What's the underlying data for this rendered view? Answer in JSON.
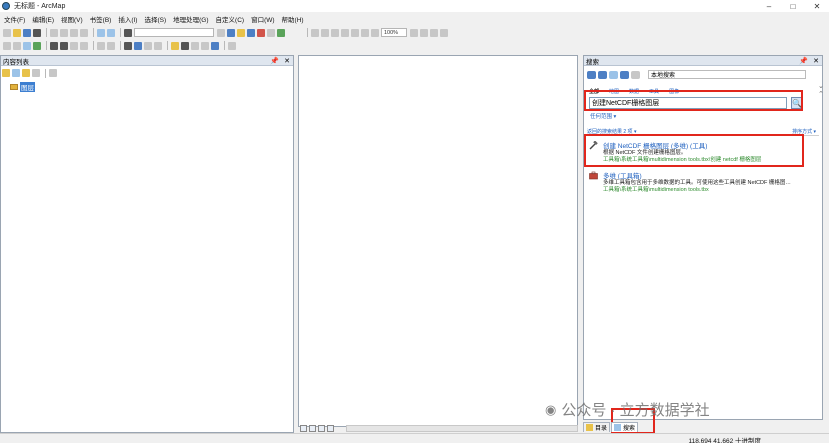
{
  "window": {
    "title": "无标题 - ArcMap",
    "minimize": "–",
    "maximize": "□",
    "close": "✕"
  },
  "menu": [
    "文件(F)",
    "编辑(E)",
    "视图(V)",
    "书签(B)",
    "插入(I)",
    "选择(S)",
    "地理处理(G)",
    "自定义(C)",
    "窗口(W)",
    "帮助(H)"
  ],
  "toolbar": {
    "zoom_value": "100%"
  },
  "toc": {
    "title": "内容列表",
    "layer_label": "图层"
  },
  "search_panel": {
    "title": "搜索",
    "scope_label": "本地搜索",
    "filters": [
      "全部",
      "地图",
      "数据",
      "工具",
      "图像"
    ],
    "query": "创建NetCDF栅格图层",
    "scope_link": "任何范围 ▾",
    "result_count": "返回的搜索结果 2 项 ▾",
    "sort_label": "排序方式 ▾",
    "results": [
      {
        "title": "创建 NetCDF 栅格图层 (多维) (工具)",
        "desc": "根据 NetCDF 文件创建栅格图层。",
        "path": "工具箱\\系统工具箱\\multidimension tools.tbx\\创建 netcdf 栅格图层"
      },
      {
        "title": "多维 (工具箱)",
        "desc": "多维工具箱包含用于多维数据的工具。可使用这些工具创建 NetCDF 栅格图…",
        "path": "工具箱\\系统工具箱\\multidimension tools.tbx"
      }
    ],
    "tabs": [
      "目录",
      "搜索"
    ]
  },
  "status": {
    "coords": "118.694  41.662 十进制度"
  },
  "watermark": {
    "name": "公众号 · 立方数据学社",
    "sub": ""
  },
  "icons": [
    "search-icon",
    "back-arrow-icon",
    "forward-arrow-icon",
    "home-icon",
    "refresh-icon",
    "folder-icon",
    "tool-hammer-icon",
    "toolbox-icon",
    "pin-icon",
    "close-icon",
    "wechat-icon"
  ]
}
